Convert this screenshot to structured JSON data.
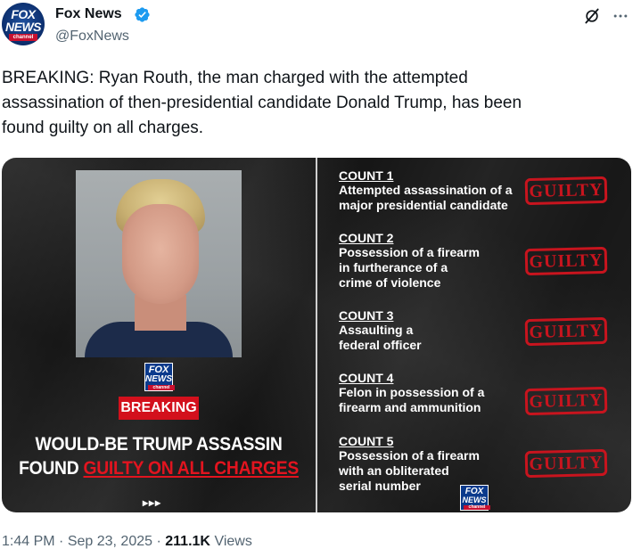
{
  "account": {
    "display_name": "Fox News",
    "handle": "@FoxNews",
    "avatar": {
      "line1": "FOX",
      "line2": "NEWS",
      "line3": "channel"
    },
    "verified_icon": "verified-badge-icon",
    "colors": {
      "verified": "#1d9bf0",
      "handle": "#536471"
    }
  },
  "tweet": {
    "text": "BREAKING: Ryan Routh, the man charged with the attempted\nassassination of then-presidential candidate Donald Trump, has been\nfound guilty on all charges."
  },
  "graphic": {
    "logo": {
      "line1": "FOX",
      "line2": "NEWS",
      "line3": "channel"
    },
    "breaking_label": "BREAKING",
    "headline_line1": "WOULD-BE TRUMP ASSASSIN",
    "headline_line2_prefix": "FOUND",
    "headline_line2_highlight": "GUILTY ON ALL CHARGES",
    "arrows": "▸▸▸",
    "counts": [
      {
        "title": "COUNT 1",
        "description": "Attempted assassination of a\nmajor presidential candidate",
        "verdict": "GUILTY"
      },
      {
        "title": "COUNT 2",
        "description": "Possession of a firearm\nin furtherance of a\ncrime of violence",
        "verdict": "GUILTY"
      },
      {
        "title": "COUNT 3",
        "description": "Assaulting a\nfederal officer",
        "verdict": "GUILTY"
      },
      {
        "title": "COUNT 4",
        "description": "Felon in possession of a\nfirearm and ammunition",
        "verdict": "GUILTY"
      },
      {
        "title": "COUNT 5",
        "description": "Possession of a firearm\nwith an obliterated\nserial number",
        "verdict": "GUILTY"
      }
    ],
    "colors": {
      "background": "#1b1b1b",
      "accent_red": "#d3101c",
      "stamp_red": "#c8141e"
    }
  },
  "meta": {
    "time": "1:44 PM",
    "separator": "·",
    "date": "Sep 23, 2025",
    "views_count": "211.1K",
    "views_label": "Views"
  }
}
